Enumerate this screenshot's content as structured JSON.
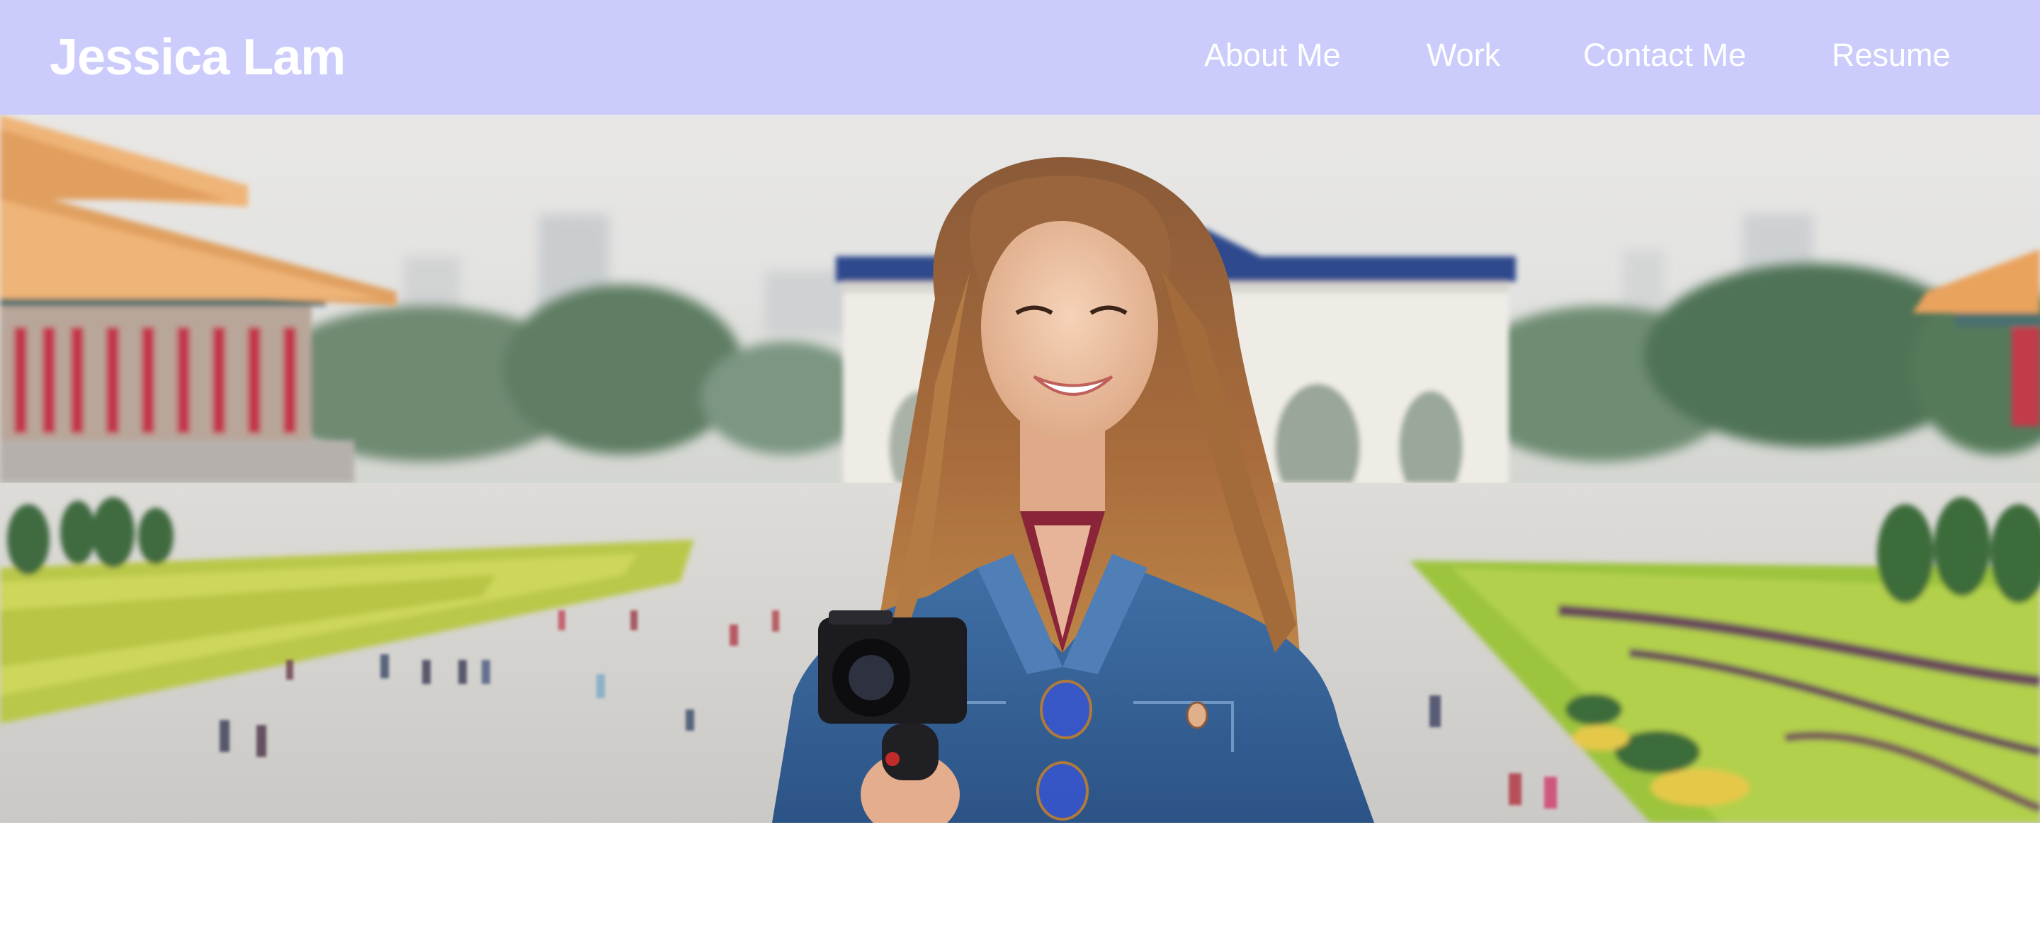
{
  "header": {
    "brand": "Jessica Lam",
    "background_color": "#ccccfc",
    "nav": [
      {
        "label": "About Me"
      },
      {
        "label": "Work"
      },
      {
        "label": "Contact Me"
      },
      {
        "label": "Resume"
      }
    ]
  },
  "hero": {
    "image": "portrait-photo",
    "description_icon": "camera-icon"
  }
}
